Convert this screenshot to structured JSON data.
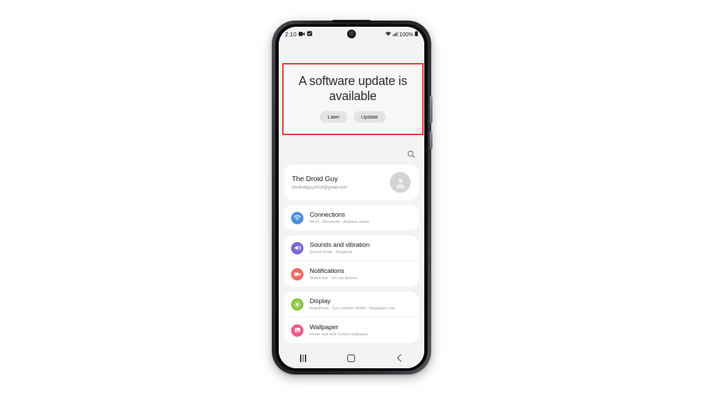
{
  "device": {
    "statusbar": {
      "time": "2:10",
      "left_icons": [
        "video-recorder-icon",
        "screenshot-icon"
      ],
      "right_icons": [
        "wifi-icon",
        "cellular-signal-icon"
      ],
      "battery_percent": "100%",
      "battery_icon": "battery-full-icon"
    },
    "navbar": {
      "recents_label": "recents-button",
      "home_label": "home-button",
      "back_label": "back-button"
    }
  },
  "update_banner": {
    "highlight_color": "#e8332f",
    "title": "A software update is available",
    "later_label": "Later",
    "update_label": "Update"
  },
  "settings": {
    "search_icon": "search-icon",
    "account": {
      "name": "The Droid Guy",
      "email": "thedroidguy2019@gmail.com",
      "avatar": "person-avatar-icon"
    },
    "groups": [
      {
        "items": [
          {
            "icon": "wifi-icon",
            "icon_color": "#4a90e2",
            "title": "Connections",
            "subtitle": "Wi-Fi  ·  Bluetooth  ·  Airplane mode"
          }
        ]
      },
      {
        "items": [
          {
            "icon": "speaker-volume-icon",
            "icon_color": "#7b68d4",
            "title": "Sounds and vibration",
            "subtitle": "Sound mode  ·  Ringtone"
          },
          {
            "icon": "notification-bell-icon",
            "icon_color": "#ee6a60",
            "title": "Notifications",
            "subtitle": "Status bar  ·  Do not disturb"
          }
        ]
      },
      {
        "items": [
          {
            "icon": "brightness-sun-icon",
            "icon_color": "#8bc53f",
            "title": "Display",
            "subtitle": "Brightness  ·  Eye comfort shield  ·  Navigation bar"
          },
          {
            "icon": "wallpaper-image-icon",
            "icon_color": "#ef5a8c",
            "title": "Wallpaper",
            "subtitle": "Home and lock screen wallpaper"
          }
        ]
      }
    ]
  }
}
